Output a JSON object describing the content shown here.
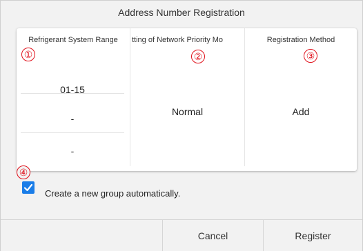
{
  "dialog": {
    "title": "Address Number Registration"
  },
  "table": {
    "columns": [
      {
        "header": "Refrigerant System Range",
        "marker": "①"
      },
      {
        "header": "tting of Network Priority Mo",
        "marker": "②"
      },
      {
        "header": "Registration Method",
        "marker": "③"
      }
    ],
    "range_values": [
      "01-15",
      "-",
      "-"
    ],
    "priority_value": "Normal",
    "method_value": "Add"
  },
  "option": {
    "marker": "④",
    "checked": true,
    "label": "Create a new group automatically."
  },
  "footer": {
    "cancel_label": "Cancel",
    "register_label": "Register"
  },
  "colors": {
    "accent": "#1a7de8",
    "marker": "#e0101a"
  }
}
